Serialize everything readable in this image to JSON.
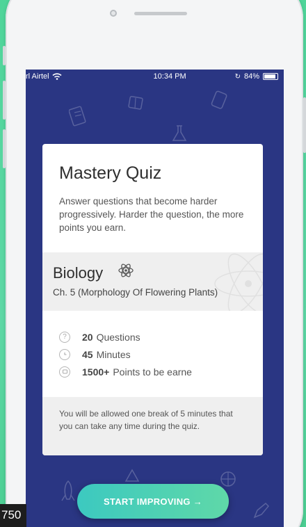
{
  "status_bar": {
    "carrier": "rl Airtel",
    "time": "10:34 PM",
    "battery": "84%"
  },
  "quiz": {
    "title": "Mastery Quiz",
    "description": "Answer questions that become harder progressively. Harder the question, the more points you earn."
  },
  "subject": {
    "name": "Biology",
    "chapter": "Ch. 5 (Morphology Of Flowering Plants)"
  },
  "stats": [
    {
      "value": "20",
      "label": "Questions",
      "icon": "question-icon"
    },
    {
      "value": "45",
      "label": "Minutes",
      "icon": "clock-icon"
    },
    {
      "value": "1500+",
      "label": "Points to be earne",
      "icon": "points-icon"
    }
  ],
  "note": "You will be allowed one break of 5 minutes that you can take any time during the quiz.",
  "cta": {
    "label": "START IMPROVING →"
  },
  "corner_badge": "750",
  "colors": {
    "background": "#4fd59a",
    "screen": "#2a3683",
    "card": "#ffffff",
    "band": "#efefef",
    "cta_start": "#3cc9c0",
    "cta_end": "#5fd8a8"
  }
}
